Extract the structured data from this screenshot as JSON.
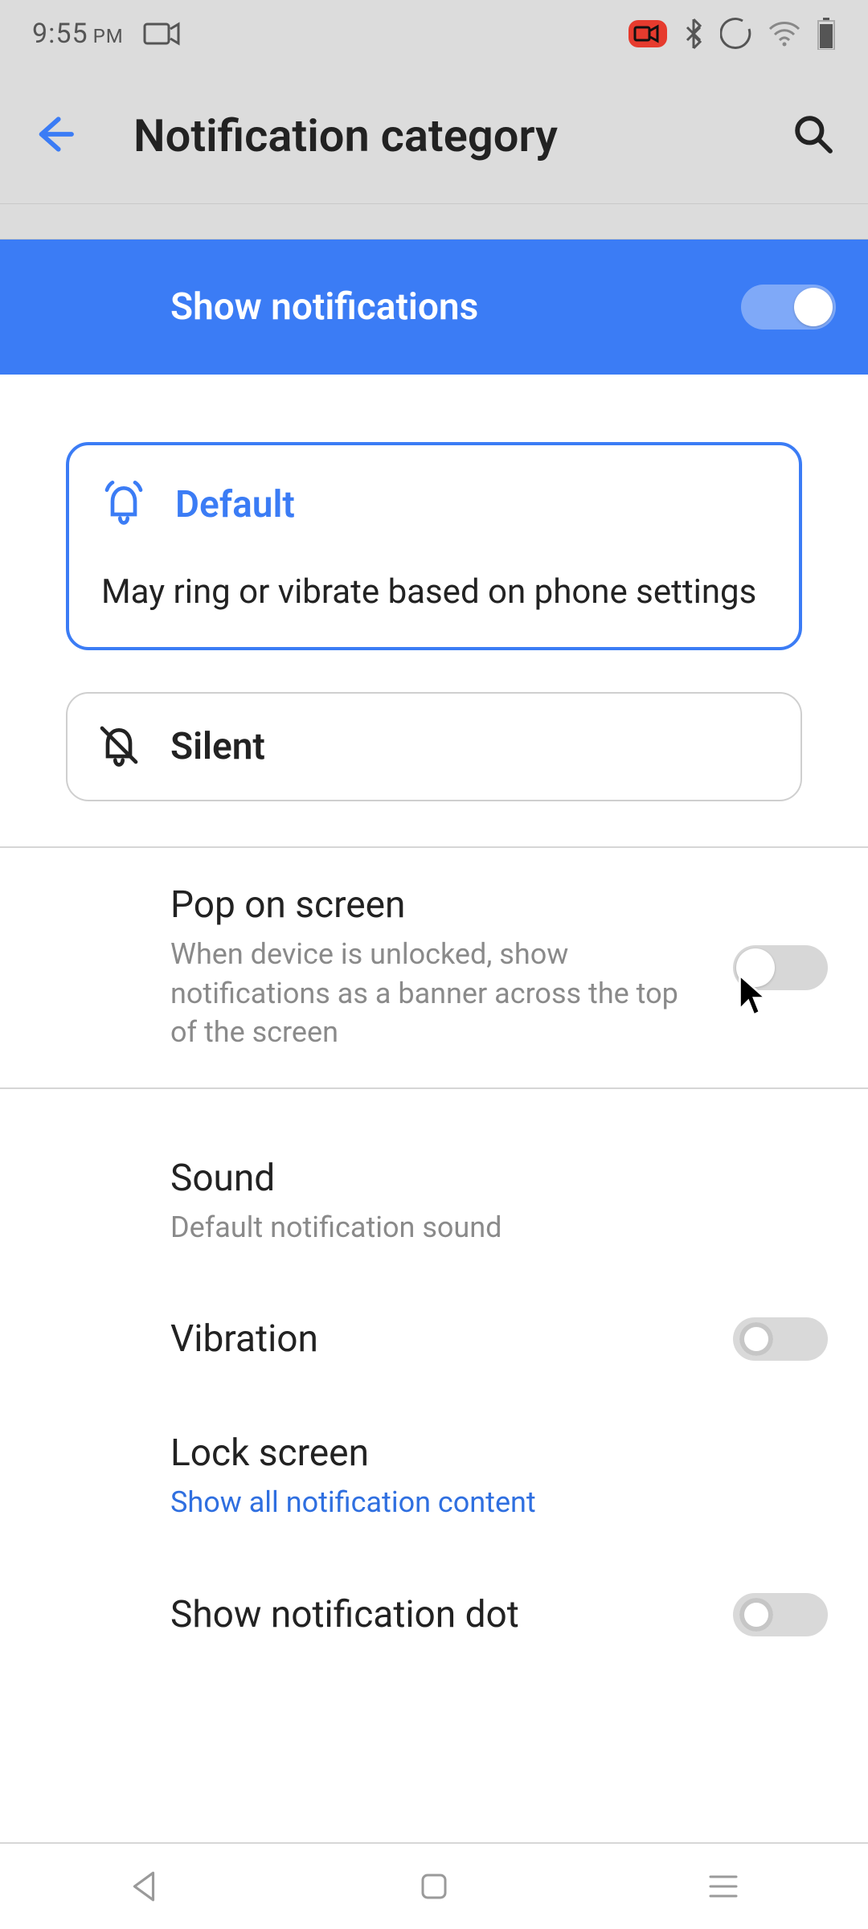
{
  "status": {
    "time": "9:55",
    "ampm": "PM"
  },
  "appbar": {
    "title": "Notification category"
  },
  "banner": {
    "label": "Show notifications",
    "enabled": true
  },
  "behaviors": {
    "default": {
      "title": "Default",
      "description": "May ring or vibrate based on phone settings",
      "selected": true
    },
    "silent": {
      "title": "Silent",
      "selected": false
    }
  },
  "settings": {
    "pop": {
      "title": "Pop on screen",
      "desc": "When device is unlocked, show notifications as a banner across the top of the screen",
      "enabled": false
    },
    "sound": {
      "title": "Sound",
      "desc": "Default notification sound"
    },
    "vibration": {
      "title": "Vibration",
      "enabled": false
    },
    "lockscreen": {
      "title": "Lock screen",
      "desc": "Show all notification content"
    },
    "dot": {
      "title": "Show notification dot",
      "enabled": false
    }
  },
  "colors": {
    "accent": "#3b7cf5"
  }
}
